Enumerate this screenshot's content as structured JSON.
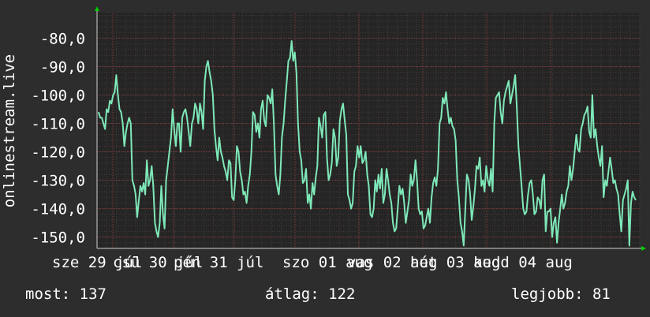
{
  "chart_data": {
    "type": "line",
    "ylabel": "onlinestream.live",
    "ylim": [
      -154,
      -71
    ],
    "y_ticks": [
      -80,
      -90,
      -100,
      -110,
      -120,
      -130,
      -140,
      -150
    ],
    "y_tick_labels": [
      "-80,0",
      "-90,0",
      "-100,0",
      "-110,0",
      "-120,0",
      "-130,0",
      "-140,0",
      "-150,0"
    ],
    "x_tick_labels": [
      "sze 29 júl",
      "csü 30 júl",
      "pén 31 júl",
      "szo 01 aug",
      "vas 02 aug",
      "hét 03 aug",
      "kedd 04 aug"
    ],
    "series": [
      {
        "color": "#7ee8b8",
        "values": [
          -106,
          -108,
          -108,
          -110,
          -112,
          -105,
          -106,
          -102,
          -103,
          -100,
          -99,
          -93,
          -100,
          -105,
          -106,
          -110,
          -118,
          -113,
          -110,
          -108,
          -110,
          -130,
          -132,
          -135,
          -143,
          -137,
          -132,
          -134,
          -131,
          -135,
          -123,
          -132,
          -130,
          -125,
          -132,
          -145,
          -148,
          -150,
          -145,
          -132,
          -142,
          -147,
          -130,
          -125,
          -120,
          -115,
          -105,
          -112,
          -118,
          -110,
          -110,
          -120,
          -108,
          -106,
          -105,
          -108,
          -113,
          -118,
          -110,
          -108,
          -103,
          -105,
          -110,
          -103,
          -106,
          -112,
          -95,
          -90,
          -88,
          -92,
          -95,
          -100,
          -112,
          -118,
          -123,
          -115,
          -120,
          -122,
          -125,
          -127,
          -130,
          -123,
          -124,
          -136,
          -137,
          -130,
          -118,
          -120,
          -127,
          -130,
          -135,
          -134,
          -138,
          -132,
          -128,
          -120,
          -106,
          -107,
          -113,
          -110,
          -115,
          -105,
          -102,
          -109,
          -111,
          -100,
          -101,
          -103,
          -98,
          -110,
          -128,
          -132,
          -135,
          -128,
          -115,
          -110,
          -102,
          -95,
          -88,
          -87,
          -81,
          -88,
          -85,
          -92,
          -110,
          -120,
          -123,
          -131,
          -130,
          -126,
          -138,
          -135,
          -140,
          -131,
          -135,
          -129,
          -125,
          -108,
          -111,
          -115,
          -107,
          -106,
          -122,
          -130,
          -128,
          -124,
          -112,
          -115,
          -125,
          -122,
          -109,
          -105,
          -103,
          -109,
          -114,
          -135,
          -137,
          -140,
          -138,
          -127,
          -125,
          -118,
          -122,
          -118,
          -124,
          -123,
          -120,
          -128,
          -132,
          -142,
          -143,
          -140,
          -130,
          -134,
          -128,
          -133,
          -126,
          -138,
          -135,
          -126,
          -130,
          -135,
          -138,
          -145,
          -148,
          -147,
          -140,
          -132,
          -135,
          -133,
          -138,
          -145,
          -141,
          -137,
          -128,
          -132,
          -130,
          -123,
          -130,
          -140,
          -142,
          -141,
          -147,
          -146,
          -143,
          -140,
          -145,
          -136,
          -131,
          -129,
          -132,
          -126,
          -110,
          -108,
          -101,
          -103,
          -99,
          -105,
          -110,
          -108,
          -111,
          -112,
          -116,
          -130,
          -136,
          -145,
          -148,
          -153,
          -140,
          -128,
          -130,
          -135,
          -144,
          -139,
          -133,
          -125,
          -126,
          -122,
          -132,
          -130,
          -134,
          -125,
          -130,
          -132,
          -126,
          -134,
          -110,
          -101,
          -100,
          -99,
          -106,
          -110,
          -102,
          -99,
          -97,
          -95,
          -103,
          -100,
          -97,
          -93,
          -104,
          -118,
          -125,
          -132,
          -140,
          -142,
          -141,
          -135,
          -131,
          -130,
          -135,
          -142,
          -141,
          -136,
          -137,
          -140,
          -130,
          -128,
          -148,
          -141,
          -141,
          -140,
          -150,
          -145,
          -143,
          -152,
          -145,
          -140,
          -135,
          -140,
          -138,
          -134,
          -132,
          -125,
          -130,
          -126,
          -120,
          -114,
          -119,
          -120,
          -112,
          -110,
          -107,
          -106,
          -104,
          -113,
          -115,
          -100,
          -115,
          -112,
          -118,
          -122,
          -125,
          -118,
          -136,
          -130,
          -132,
          -127,
          -122,
          -126,
          -131,
          -130,
          -133,
          -135,
          -142,
          -148,
          -137,
          -135,
          -133,
          -130,
          -153,
          -138,
          -134,
          -136,
          -137
        ]
      }
    ]
  },
  "footer": {
    "current": "most: 137",
    "average": "átlag: 122",
    "best": "legjobb: 81"
  }
}
